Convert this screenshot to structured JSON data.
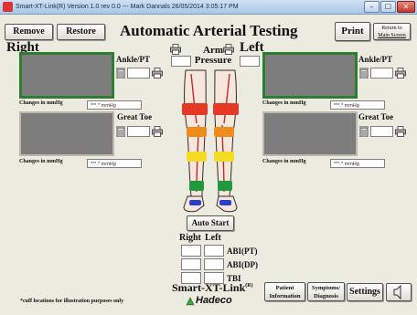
{
  "window": {
    "title": "Smart-XT-Link(R)  Version 1.0 rev 0.0  --- Mark Dannals  26/05/2014   3:05:17 PM",
    "minimize": "–",
    "maximize": "☐",
    "close": "✕"
  },
  "toolbar": {
    "remove_label": "Remove",
    "restore_label": "Restore",
    "print_label": "Print",
    "return_label_1": "Return to",
    "return_label_2": "Main Screen"
  },
  "page_title": "Automatic Arterial Testing",
  "arm_pressure": {
    "line1": "Arm",
    "line2": "Pressure"
  },
  "right": {
    "title": "Right",
    "ankle_label": "Ankle/PT",
    "great_toe_label": "Great Toe",
    "changes_label_top": "Changes in mmHg",
    "changes_label_bottom": "Changes in mmHg",
    "changes_value_top": "***.*",
    "changes_value_bottom": "***.*",
    "unit": "mmHg"
  },
  "left": {
    "title": "Left",
    "ankle_label": "Ankle/PT",
    "great_toe_label": "Great Toe",
    "changes_label_top": "Changes in mmHg",
    "changes_label_bottom": "Changes in mmHg",
    "changes_value_top": "***.*",
    "changes_value_bottom": "***.*",
    "unit": "mmHg"
  },
  "auto_start_label": "Auto Start",
  "results": {
    "right_header": "Right",
    "left_header": "Left",
    "rows": [
      "ABI(PT)",
      "ABI(DP)",
      "TBI"
    ]
  },
  "footer": {
    "note": "*cuff locations for illustration purposes only",
    "brand": "Smart-XT-Link",
    "brand_sup": "(R)",
    "company": "Hadeco",
    "patient_info_1": "Patient",
    "patient_info_2": "Information",
    "symptoms_1": "Symptoms/",
    "symptoms_2": "Diagnosis",
    "settings_label": "Settings"
  },
  "colors": {
    "screen_active_border": "#2e7d32",
    "cuff_red": "#e53925",
    "cuff_orange": "#f08c1e",
    "cuff_yellow": "#f3dc22",
    "cuff_green": "#1e9a3c",
    "cuff_blue": "#2a3fcf"
  },
  "icons": [
    "printer-icon",
    "trash-icon",
    "speaker-icon",
    "hadeco-logo-icon"
  ]
}
